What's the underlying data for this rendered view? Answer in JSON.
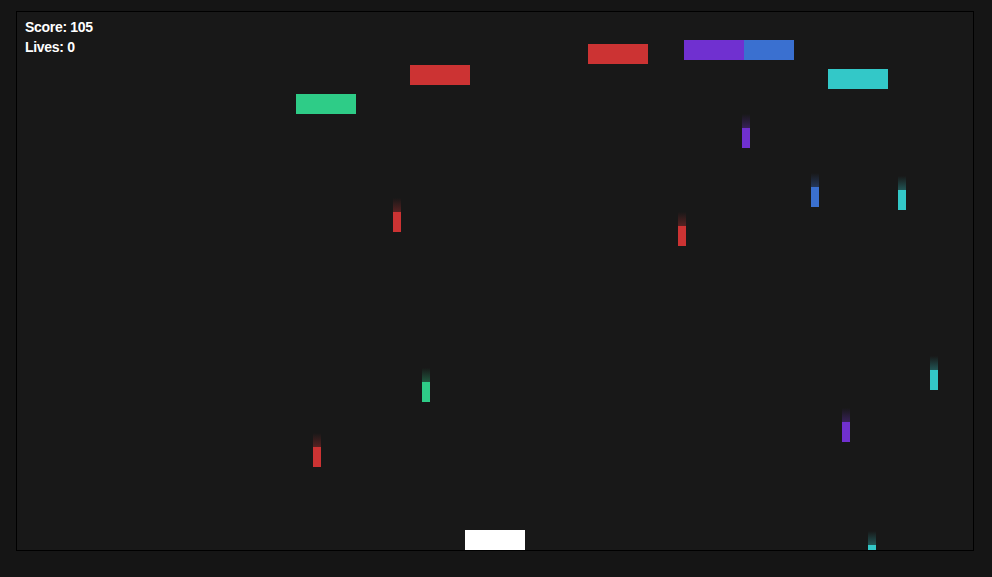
{
  "hud": {
    "score": "Score: 105",
    "lives": "Lives: 0"
  },
  "enemies": [
    {
      "color": "#2ecc87"
    },
    {
      "color": "#cc3333"
    },
    {
      "color": "#cc3333"
    },
    {
      "color": "#3a70d0"
    },
    {
      "color": "#7030d0"
    },
    {
      "color": "#33c8c8"
    }
  ],
  "bullets": [
    {
      "color": "#7030d0"
    },
    {
      "color": "#3a70d0"
    },
    {
      "color": "#33c8c8"
    },
    {
      "color": "#cc3333"
    },
    {
      "color": "#cc3333"
    },
    {
      "color": "#2ecc87"
    },
    {
      "color": "#33c8c8"
    },
    {
      "color": "#7030d0"
    },
    {
      "color": "#cc3333"
    },
    {
      "color": "#33c8c8"
    }
  ]
}
